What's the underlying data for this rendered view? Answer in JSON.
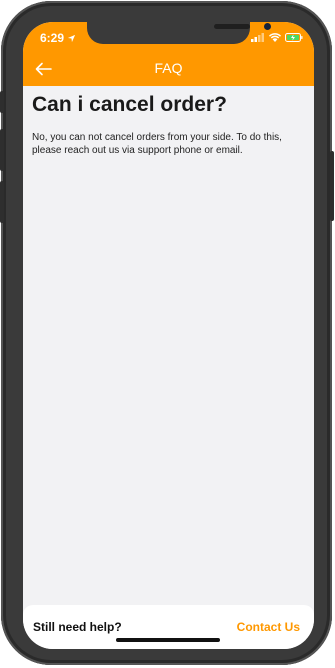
{
  "status_bar": {
    "time": "6:29",
    "icons": [
      "location-arrow-icon",
      "signal-icon",
      "wifi-icon",
      "battery-charging-icon"
    ]
  },
  "app_bar": {
    "title": "FAQ",
    "back_icon": "arrow-left-icon"
  },
  "faq": {
    "question": "Can i cancel order?",
    "answer": "No, you can not cancel orders from your side. To do this, please reach out us via support phone or email."
  },
  "footer": {
    "help_text": "Still need help?",
    "contact_label": "Contact Us"
  },
  "colors": {
    "accent": "#ff9800",
    "background": "#f2f2f4",
    "phone_frame": "#3a3a3a",
    "battery": "#4cd964"
  }
}
